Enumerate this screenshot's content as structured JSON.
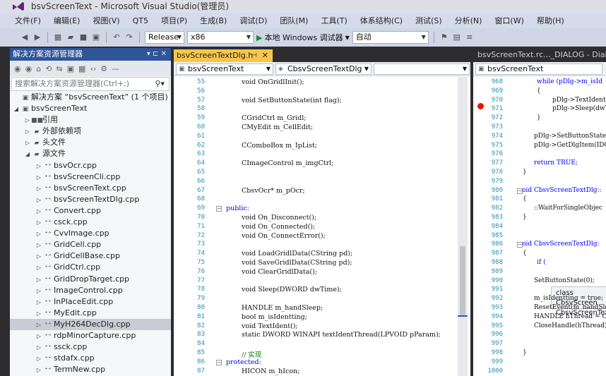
{
  "window": {
    "title": "bsvScreenText - Microsoft Visual Studio(管理员)"
  },
  "menu": [
    "文件(F)",
    "编辑(E)",
    "视图(V)",
    "QT5",
    "项目(P)",
    "生成(B)",
    "调试(D)",
    "团队(M)",
    "工具(T)",
    "体系结构(C)",
    "测试(S)",
    "分析(N)",
    "窗口(W)",
    "帮助(H)"
  ],
  "toolbar": {
    "config": "Release",
    "platform": "x86",
    "start_label": "本地 Windows 调试器",
    "auto": "自动"
  },
  "solution_explorer": {
    "title": "解决方案资源管理器",
    "search_placeholder": "搜索解决方案资源管理器(Ctrl+;)",
    "solution_label": "解决方案 “bsvScreenText” (1 个项目)",
    "project": "bsvScreenText",
    "folders": [
      "引用",
      "外部依赖项",
      "头文件",
      "源文件"
    ],
    "files": [
      "bsvOcr.cpp",
      "bsvScreenCli.cpp",
      "bsvScreenText.cpp",
      "bsvScreenTextDlg.cpp",
      "Convert.cpp",
      "csck.cpp",
      "CvvImage.cpp",
      "GridCell.cpp",
      "GridCellBase.cpp",
      "GridCtrl.cpp",
      "GridDropTarget.cpp",
      "ImageControl.cpp",
      "InPlaceEdit.cpp",
      "MyEdit.cpp",
      "MyH264DecDlg.cpp",
      "rdpMinorCapture.cpp",
      "ssck.cpp",
      "stdafx.cpp",
      "TermNew.cpp"
    ],
    "selected_file": "MyH264DecDlg.cpp"
  },
  "editor": {
    "tab": "bsvScreenTextDlg.h",
    "nav_left": "bsvScreenText",
    "nav_right": "CbsvScreenTextDlg",
    "lines": [
      {
        "n": "55",
        "code": "void OnGridlInit();"
      },
      {
        "n": "56",
        "code": ""
      },
      {
        "n": "57",
        "code": "void SetButtonState(int flag);"
      },
      {
        "n": "58",
        "code": ""
      },
      {
        "n": "59",
        "code": "CGridCtrl m_Gridl;"
      },
      {
        "n": "60",
        "code": "CMyEdit m_CellEdit;"
      },
      {
        "n": "61",
        "code": ""
      },
      {
        "n": "62",
        "code": "CComboBox m_IpList;"
      },
      {
        "n": "63",
        "code": ""
      },
      {
        "n": "64",
        "code": "CImageControl m_imgCtrl;"
      },
      {
        "n": "65",
        "code": ""
      },
      {
        "n": "66",
        "code": ""
      },
      {
        "n": "67",
        "code": "CbsvOcr* m_pOcr;"
      },
      {
        "n": "68",
        "code": ""
      },
      {
        "n": "69",
        "code": "public:"
      },
      {
        "n": "70",
        "code": "void On_Disconnect();"
      },
      {
        "n": "71",
        "code": "void On_Connected();"
      },
      {
        "n": "72",
        "code": "void On_ConnectError();"
      },
      {
        "n": "73",
        "code": ""
      },
      {
        "n": "74",
        "code": "void LoadGridlData(CString pd);"
      },
      {
        "n": "75",
        "code": "void SaveGridlData(CString pd);"
      },
      {
        "n": "76",
        "code": "void ClearGridlData();"
      },
      {
        "n": "77",
        "code": ""
      },
      {
        "n": "78",
        "code": "void Sleep(DWORD dwTime);"
      },
      {
        "n": "79",
        "code": ""
      },
      {
        "n": "80",
        "code": "HANDLE m_handSleep;"
      },
      {
        "n": "81",
        "code": "bool m_isIdentting;"
      },
      {
        "n": "82",
        "code": "void TextIdent();"
      },
      {
        "n": "83",
        "code": "static DWORD WINAPI textIdentThread(LPVOID pParam);"
      },
      {
        "n": "84",
        "code": ""
      },
      {
        "n": "85",
        "code": "// 实现"
      },
      {
        "n": "86",
        "code": "protected:"
      },
      {
        "n": "87",
        "code": "HICON m_hIcon;"
      }
    ]
  },
  "right_pane": {
    "tab": "bsvScreenText.rc..._DIALOG - Dialog",
    "nav": "bsvScreenText",
    "lines": [
      {
        "n": "968",
        "code": "while (pDlg->m_isId"
      },
      {
        "n": "969",
        "code": "{"
      },
      {
        "n": "970",
        "code": "pDlg->TextIdent"
      },
      {
        "n": "971",
        "code": "pDlg->Sleep(dwT"
      },
      {
        "n": "972",
        "code": "}"
      },
      {
        "n": "973",
        "code": ""
      },
      {
        "n": "974",
        "code": "pDlg->SetButtonState"
      },
      {
        "n": "975",
        "code": "pDlg->GetDlgItem(IDC"
      },
      {
        "n": "976",
        "code": ""
      },
      {
        "n": "977",
        "code": "return TRUE;"
      },
      {
        "n": "978",
        "code": "}"
      },
      {
        "n": "979",
        "code": ""
      },
      {
        "n": "980",
        "code": "void CbsvScreenTextDlg::"
      },
      {
        "n": "981",
        "code": "{"
      },
      {
        "n": "982",
        "code": "::WaitForSingleObjec"
      },
      {
        "n": "983",
        "code": "}"
      },
      {
        "n": "984",
        "code": ""
      },
      {
        "n": "985",
        "code": ""
      },
      {
        "n": "986",
        "code": "void CbsvScreenTextDlg:"
      },
      {
        "n": "987",
        "code": "{"
      },
      {
        "n": "988",
        "code": "if ("
      },
      {
        "n": "989",
        "code": ""
      },
      {
        "n": "990",
        "code": "SetButtonState(0);"
      },
      {
        "n": "991",
        "code": ""
      },
      {
        "n": "992",
        "code": "m_isIdentting = true;"
      },
      {
        "n": "993",
        "code": "ResetEvent(m_handSlee"
      },
      {
        "n": "994",
        "code": "HANDLE hThread = Crea"
      },
      {
        "n": "995",
        "code": "CloseHandle(hThread);"
      },
      {
        "n": "996",
        "code": ""
      },
      {
        "n": "997",
        "code": ""
      },
      {
        "n": "998",
        "code": "}"
      },
      {
        "n": "999",
        "code": ""
      },
      {
        "n": "1000",
        "code": ""
      }
    ],
    "tooltip": [
      "class CbsvScreen",
      "CbsvScreenTex"
    ]
  },
  "colors": {
    "accent": "#2f5596",
    "tab_active": "#f6c64b",
    "keyword": "#0000ff"
  }
}
